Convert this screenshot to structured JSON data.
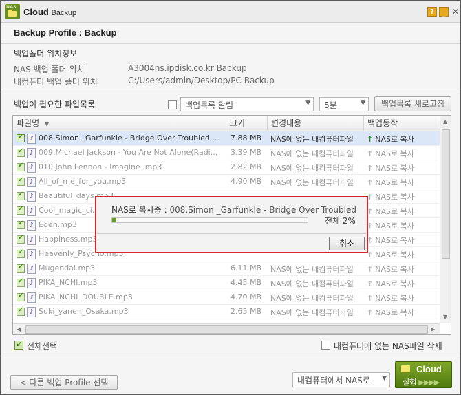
{
  "window": {
    "app_name": "Cloud",
    "app_name_suffix": "Backup",
    "logo_text": "NAS",
    "help_label": "?",
    "minimize_label": "_",
    "close_label": "✕"
  },
  "profile": {
    "header": "Backup Profile : Backup"
  },
  "folder_info": {
    "section_title": "백업폴더 위치정보",
    "nas_label": "NAS 백업 폴더 위치",
    "nas_value": "A3004ns.ipdisk.co.kr  Backup",
    "pc_label": "내컴퓨터 백업 폴더 위치",
    "pc_value": "C:/Users/admin/Desktop/PC Backup"
  },
  "list_controls": {
    "title": "백업이 필요한 파일목록",
    "notify_label": "백업목록 알림",
    "notify_checked": false,
    "interval_value": "5분",
    "refresh_label": "백업목록 새로고침"
  },
  "table": {
    "columns": [
      "파일명",
      "크기",
      "변경내용",
      "백업동작"
    ],
    "sort_indicator": "▼",
    "rows": [
      {
        "name": "008.Simon _Garfunkle - Bridge Over Troubled ...",
        "size": "7.88 MB",
        "change": "NAS에 없는 내컴퓨터파일",
        "action": "NAS로 복사",
        "selected": true
      },
      {
        "name": "009.Michael Jackson - You Are Not Alone(Radi...",
        "size": "3.39 MB",
        "change": "NAS에 없는 내컴퓨터파일",
        "action": "NAS로 복사",
        "selected": false
      },
      {
        "name": "010.John Lennon - Imagine .mp3",
        "size": "2.82 MB",
        "change": "NAS에 없는 내컴퓨터파일",
        "action": "NAS로 복사",
        "selected": false
      },
      {
        "name": "All_of_me_for_you.mp3",
        "size": "4.90 MB",
        "change": "NAS에 없는 내컴퓨터파일",
        "action": "NAS로 복사",
        "selected": false
      },
      {
        "name": "Beautiful_days.mp3",
        "size": "",
        "change": "",
        "action": "NAS로 복사",
        "selected": false
      },
      {
        "name": "Cool_magic_ci...",
        "size": "",
        "change": "",
        "action": "NAS로 복사",
        "selected": false
      },
      {
        "name": "Eden.mp3",
        "size": "",
        "change": "",
        "action": "NAS로 복사",
        "selected": false
      },
      {
        "name": "Happiness.mp3",
        "size": "",
        "change": "",
        "action": "NAS로 복사",
        "selected": false
      },
      {
        "name": "Heavenly_Psycho.mp3",
        "size": "",
        "change": "",
        "action": "NAS로 복사",
        "selected": false
      },
      {
        "name": "Mugendai.mp3",
        "size": "6.11 MB",
        "change": "NAS에 없는 내컴퓨터파일",
        "action": "NAS로 복사",
        "selected": false
      },
      {
        "name": "PIKA_NCHI.mp3",
        "size": "4.45 MB",
        "change": "NAS에 없는 내컴퓨터파일",
        "action": "NAS로 복사",
        "selected": false
      },
      {
        "name": "PIKA_NCHI_DOUBLE.mp3",
        "size": "4.70 MB",
        "change": "NAS에 없는 내컴퓨터파일",
        "action": "NAS로 복사",
        "selected": false
      },
      {
        "name": "Suki_yanen_Osaka.mp3",
        "size": "2.65 MB",
        "change": "NAS에 없는 내컴퓨터파일",
        "action": "NAS로 복사",
        "selected": false
      }
    ]
  },
  "dialog": {
    "prefix": "NAS로 복사중 :",
    "filename": "008.Simon _Garfunkle - Bridge Over Troubled ...",
    "percent_label": "전체 2%",
    "progress": 0.02,
    "cancel_label": "취소"
  },
  "footer": {
    "select_all_label": "전체선택",
    "select_all_checked": true,
    "delete_label": "내컴퓨터에 없는 NAS파일 삭제",
    "delete_checked": false,
    "back_label": "< 다른 백업 Profile 선택",
    "direction_value": "내컴퓨터에서 NAS로",
    "run_title": "Cloud",
    "run_label": "실행",
    "run_dots": "▶▶▶▶"
  },
  "colors": {
    "accent": "#6a9b2a",
    "dialog_border": "#d8252b",
    "selected_row": "#dbe7f7"
  }
}
